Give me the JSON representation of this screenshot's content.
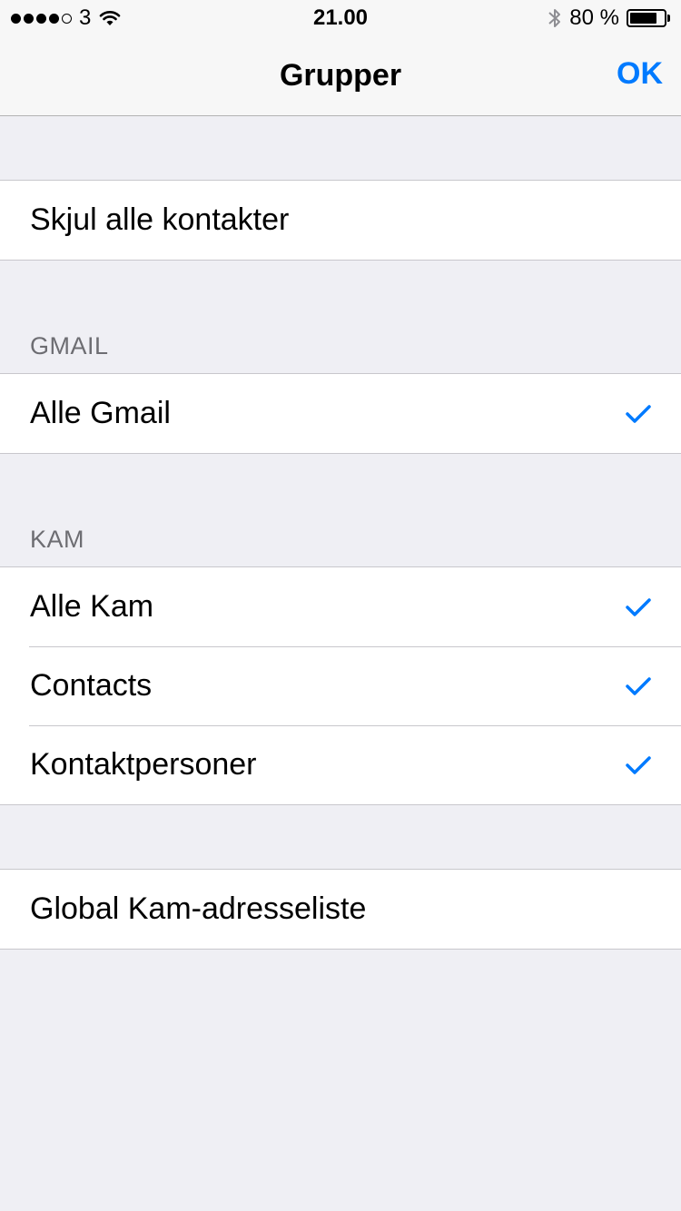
{
  "status_bar": {
    "carrier": "3",
    "time": "21.00",
    "battery": "80 %",
    "battery_level": 0.8,
    "icons": [
      "signal-dots",
      "wifi-icon",
      "bluetooth-icon",
      "battery-icon"
    ]
  },
  "nav": {
    "title": "Grupper",
    "done_label": "OK"
  },
  "accent_color": "#007aff",
  "sections": {
    "hide_all": {
      "label": "Skjul alle kontakter"
    },
    "gmail": {
      "header": "GMAIL",
      "items": [
        {
          "label": "Alle Gmail",
          "checked": true
        }
      ]
    },
    "kam": {
      "header": "KAM",
      "items": [
        {
          "label": "Alle Kam",
          "checked": true
        },
        {
          "label": "Contacts",
          "checked": true
        },
        {
          "label": "Kontaktpersoner",
          "checked": true
        }
      ]
    },
    "global": {
      "label": "Global Kam-adresseliste"
    }
  }
}
